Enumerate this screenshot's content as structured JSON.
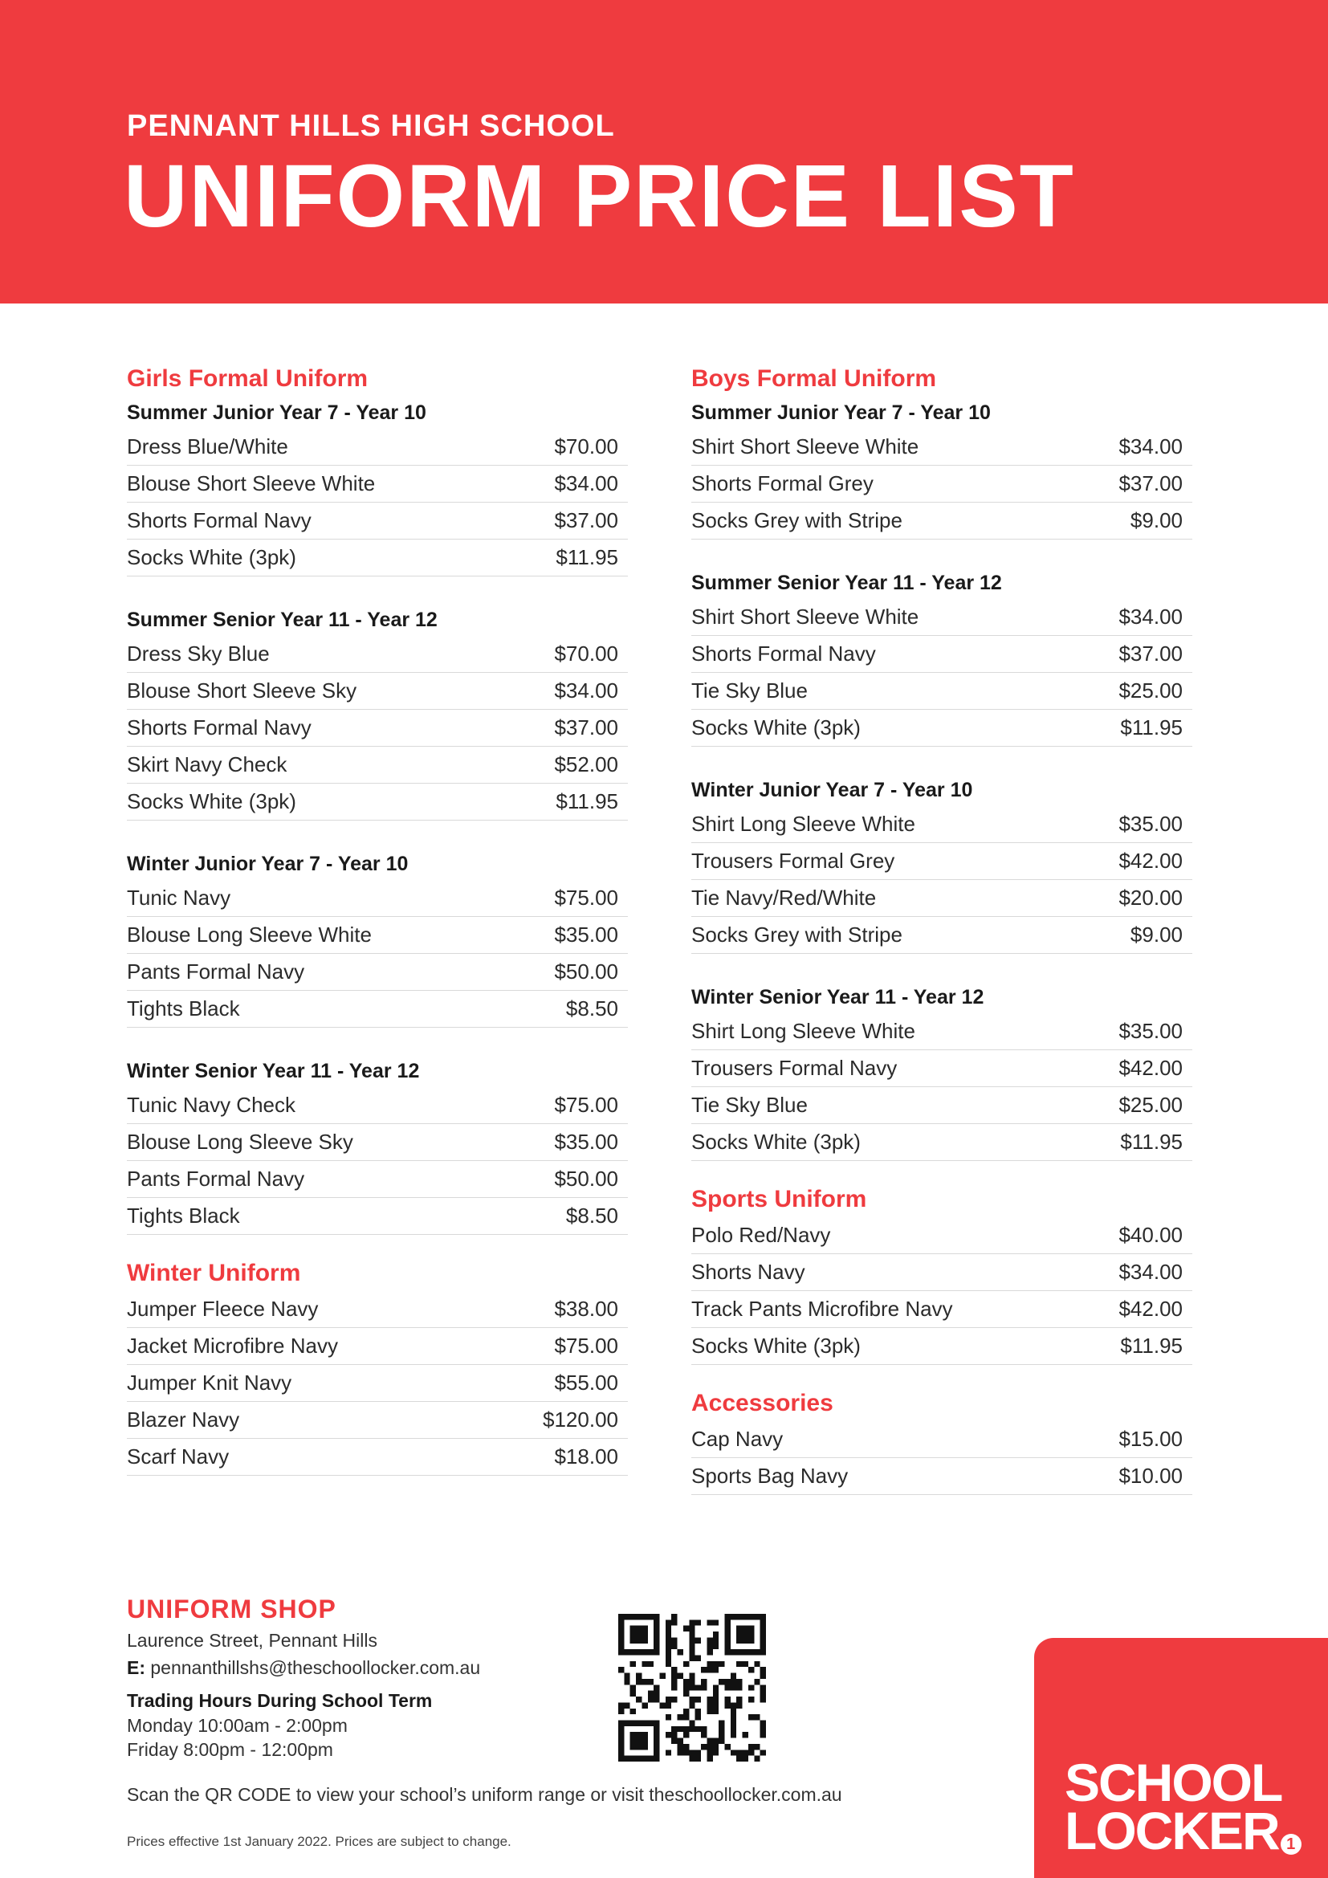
{
  "header": {
    "school": "PENNANT HILLS HIGH SCHOOL",
    "title": "UNIFORM PRICE LIST"
  },
  "left_column": [
    {
      "title": "Girls Formal Uniform",
      "groups": [
        {
          "subtitle": "Summer Junior Year 7 - Year 10",
          "items": [
            {
              "name": "Dress Blue/White",
              "price": "$70.00"
            },
            {
              "name": "Blouse Short Sleeve White",
              "price": "$34.00"
            },
            {
              "name": "Shorts Formal Navy",
              "price": "$37.00"
            },
            {
              "name": "Socks White (3pk)",
              "price": "$11.95"
            }
          ]
        },
        {
          "subtitle": "Summer Senior Year 11 - Year 12",
          "items": [
            {
              "name": "Dress Sky Blue",
              "price": "$70.00"
            },
            {
              "name": "Blouse Short Sleeve Sky",
              "price": "$34.00"
            },
            {
              "name": "Shorts Formal Navy",
              "price": "$37.00"
            },
            {
              "name": "Skirt Navy Check",
              "price": "$52.00"
            },
            {
              "name": "Socks White (3pk)",
              "price": "$11.95"
            }
          ]
        },
        {
          "subtitle": "Winter Junior Year 7 - Year 10",
          "items": [
            {
              "name": "Tunic Navy",
              "price": "$75.00"
            },
            {
              "name": "Blouse Long Sleeve White",
              "price": "$35.00"
            },
            {
              "name": "Pants Formal Navy",
              "price": "$50.00"
            },
            {
              "name": "Tights Black",
              "price": "$8.50"
            }
          ]
        },
        {
          "subtitle": "Winter Senior Year 11 - Year 12",
          "items": [
            {
              "name": "Tunic Navy Check",
              "price": "$75.00"
            },
            {
              "name": "Blouse Long Sleeve Sky",
              "price": "$35.00"
            },
            {
              "name": "Pants Formal Navy",
              "price": "$50.00"
            },
            {
              "name": "Tights Black",
              "price": "$8.50"
            }
          ]
        }
      ]
    },
    {
      "title": "Winter Uniform",
      "groups": [
        {
          "subtitle": "",
          "items": [
            {
              "name": "Jumper Fleece Navy",
              "price": "$38.00"
            },
            {
              "name": "Jacket Microfibre Navy",
              "price": "$75.00"
            },
            {
              "name": "Jumper Knit Navy",
              "price": "$55.00"
            },
            {
              "name": "Blazer Navy",
              "price": "$120.00"
            },
            {
              "name": "Scarf Navy",
              "price": "$18.00"
            }
          ]
        }
      ]
    }
  ],
  "right_column": [
    {
      "title": "Boys Formal Uniform",
      "groups": [
        {
          "subtitle": "Summer Junior Year 7 - Year 10",
          "items": [
            {
              "name": "Shirt Short Sleeve White",
              "price": "$34.00"
            },
            {
              "name": "Shorts Formal Grey",
              "price": "$37.00"
            },
            {
              "name": "Socks Grey with Stripe",
              "price": "$9.00"
            }
          ]
        },
        {
          "subtitle": "Summer Senior Year 11 - Year 12",
          "items": [
            {
              "name": "Shirt Short Sleeve White",
              "price": "$34.00"
            },
            {
              "name": "Shorts Formal Navy",
              "price": "$37.00"
            },
            {
              "name": "Tie Sky Blue",
              "price": "$25.00"
            },
            {
              "name": "Socks White (3pk)",
              "price": "$11.95"
            }
          ]
        },
        {
          "subtitle": "Winter Junior Year 7 - Year 10",
          "items": [
            {
              "name": "Shirt Long Sleeve White",
              "price": "$35.00"
            },
            {
              "name": "Trousers Formal Grey",
              "price": "$42.00"
            },
            {
              "name": "Tie Navy/Red/White",
              "price": "$20.00"
            },
            {
              "name": "Socks Grey with Stripe",
              "price": "$9.00"
            }
          ]
        },
        {
          "subtitle": "Winter Senior Year 11 - Year 12",
          "items": [
            {
              "name": "Shirt Long Sleeve White",
              "price": "$35.00"
            },
            {
              "name": "Trousers Formal Navy",
              "price": "$42.00"
            },
            {
              "name": "Tie Sky Blue",
              "price": "$25.00"
            },
            {
              "name": "Socks White (3pk)",
              "price": "$11.95"
            }
          ]
        }
      ]
    },
    {
      "title": "Sports Uniform",
      "groups": [
        {
          "subtitle": "",
          "items": [
            {
              "name": "Polo Red/Navy",
              "price": "$40.00"
            },
            {
              "name": "Shorts Navy",
              "price": "$34.00"
            },
            {
              "name": "Track Pants Microfibre Navy",
              "price": "$42.00"
            },
            {
              "name": "Socks White (3pk)",
              "price": "$11.95"
            }
          ]
        }
      ]
    },
    {
      "title": "Accessories",
      "groups": [
        {
          "subtitle": "",
          "items": [
            {
              "name": "Cap Navy",
              "price": "$15.00"
            },
            {
              "name": "Sports Bag Navy",
              "price": "$10.00"
            }
          ]
        }
      ]
    }
  ],
  "shop": {
    "title": "UNIFORM SHOP",
    "address": "Laurence Street, Pennant Hills",
    "email_label": "E:",
    "email": "pennanthillshs@theschoollocker.com.au",
    "hours_title": "Trading Hours During School Term",
    "hours": [
      "Monday 10:00am - 2:00pm",
      "Friday 8:00pm - 12:00pm"
    ]
  },
  "scan_text": "Scan the QR CODE to view your school’s uniform range or visit theschoollocker.com.au",
  "disclaimer": "Prices effective 1st January 2022. Prices are subject to change.",
  "logo": {
    "line1": "SCHOOL",
    "line2": "LOCKER"
  },
  "colors": {
    "accent": "#ef3b3f",
    "text": "#222222",
    "rule": "#d9d9d9"
  },
  "icons": {
    "qr": "qr-code-icon",
    "logo": "school-locker-logo"
  }
}
